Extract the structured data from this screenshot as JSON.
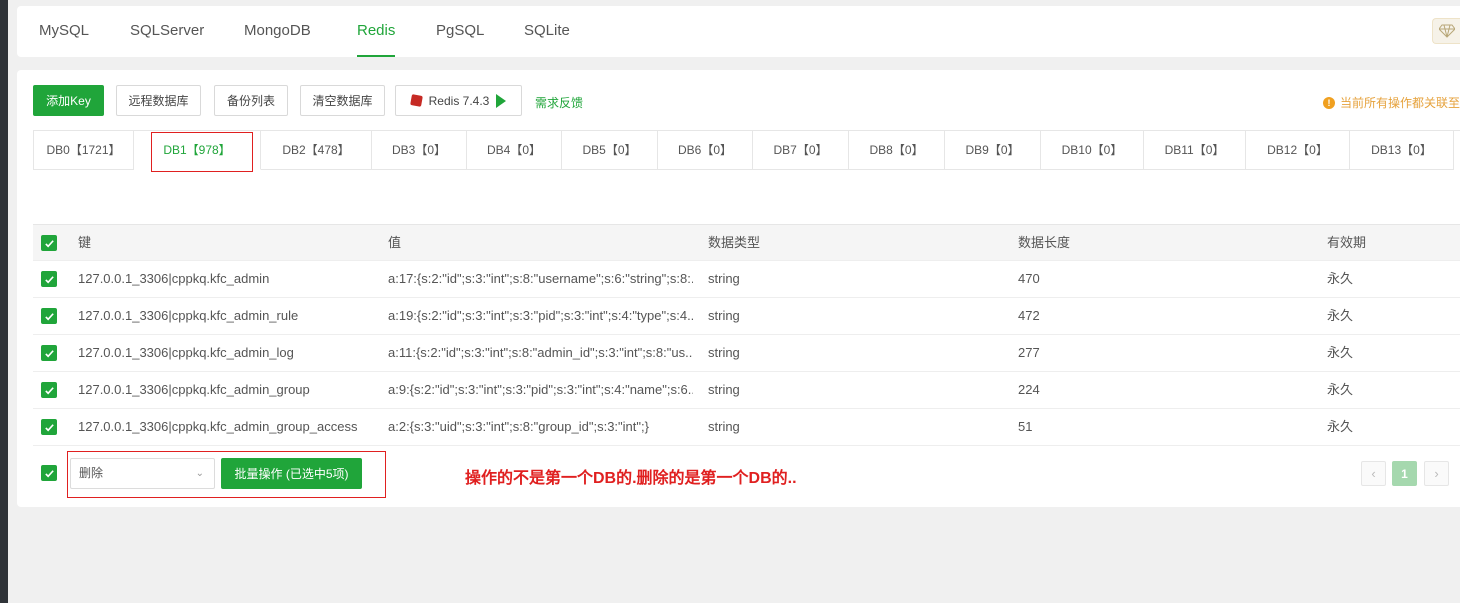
{
  "top_tabs": [
    {
      "label": "MySQL",
      "active": false
    },
    {
      "label": "SQLServer",
      "active": false
    },
    {
      "label": "MongoDB",
      "active": false
    },
    {
      "label": "Redis",
      "active": true
    },
    {
      "label": "PgSQL",
      "active": false
    },
    {
      "label": "SQLite",
      "active": false
    }
  ],
  "toolbar": {
    "add_key": "添加Key",
    "remote_db": "远程数据库",
    "backup_list": "备份列表",
    "clear_db": "清空数据库",
    "redis_version": "Redis 7.4.3",
    "feedback": "需求反馈",
    "notice": "当前所有操作都关联至"
  },
  "db_tabs": [
    {
      "label": "DB0【1721】",
      "active": false
    },
    {
      "label": "DB1【978】",
      "active": true
    },
    {
      "label": "DB2【478】",
      "active": false
    },
    {
      "label": "DB3【0】",
      "active": false
    },
    {
      "label": "DB4【0】",
      "active": false
    },
    {
      "label": "DB5【0】",
      "active": false
    },
    {
      "label": "DB6【0】",
      "active": false
    },
    {
      "label": "DB7【0】",
      "active": false
    },
    {
      "label": "DB8【0】",
      "active": false
    },
    {
      "label": "DB9【0】",
      "active": false
    },
    {
      "label": "DB10【0】",
      "active": false
    },
    {
      "label": "DB11【0】",
      "active": false
    },
    {
      "label": "DB12【0】",
      "active": false
    },
    {
      "label": "DB13【0】",
      "active": false
    }
  ],
  "table": {
    "headers": {
      "key": "键",
      "value": "值",
      "type": "数据类型",
      "length": "数据长度",
      "ttl": "有效期"
    },
    "rows": [
      {
        "key": "127.0.0.1_3306|cppkq.kfc_admin",
        "value": "a:17:{s:2:\"id\";s:3:\"int\";s:8:\"username\";s:6:\"string\";s:8:...",
        "type": "string",
        "length": "470",
        "ttl": "永久",
        "checked": true
      },
      {
        "key": "127.0.0.1_3306|cppkq.kfc_admin_rule",
        "value": "a:19:{s:2:\"id\";s:3:\"int\";s:3:\"pid\";s:3:\"int\";s:4:\"type\";s:4...",
        "type": "string",
        "length": "472",
        "ttl": "永久",
        "checked": true
      },
      {
        "key": "127.0.0.1_3306|cppkq.kfc_admin_log",
        "value": "a:11:{s:2:\"id\";s:3:\"int\";s:8:\"admin_id\";s:3:\"int\";s:8:\"us...",
        "type": "string",
        "length": "277",
        "ttl": "永久",
        "checked": true
      },
      {
        "key": "127.0.0.1_3306|cppkq.kfc_admin_group",
        "value": "a:9:{s:2:\"id\";s:3:\"int\";s:3:\"pid\";s:3:\"int\";s:4:\"name\";s:6...",
        "type": "string",
        "length": "224",
        "ttl": "永久",
        "checked": true
      },
      {
        "key": "127.0.0.1_3306|cppkq.kfc_admin_group_access",
        "value": "a:2:{s:3:\"uid\";s:3:\"int\";s:8:\"group_id\";s:3:\"int\";}",
        "type": "string",
        "length": "51",
        "ttl": "永久",
        "checked": true
      }
    ]
  },
  "footer": {
    "action_select": "删除",
    "batch_button": "批量操作 (已选中5项)",
    "annotation": "操作的不是第一个DB的.删除的是第一个DB的..",
    "page": "1",
    "prev": "‹",
    "next": "›"
  },
  "colors": {
    "accent": "#20a53a",
    "annotation": "#e02020",
    "warning": "#e6a23c"
  }
}
